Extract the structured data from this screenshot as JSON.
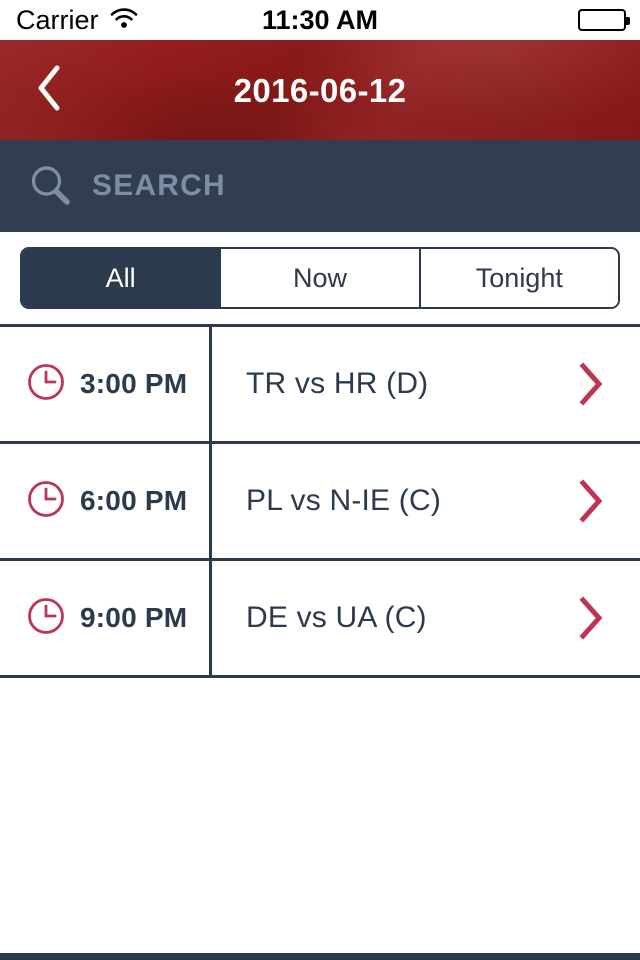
{
  "status_bar": {
    "carrier": "Carrier",
    "wifi_icon": "wifi-icon",
    "time": "11:30 AM",
    "battery_icon": "battery-full-icon"
  },
  "header": {
    "back_icon": "chevron-left-icon",
    "title": "2016-06-12",
    "background_color": "#8f1b1b"
  },
  "search": {
    "icon": "search-icon",
    "placeholder": "SEARCH",
    "value": "",
    "background_color": "#313e51",
    "placeholder_color": "#7e8da3"
  },
  "filters": {
    "selected": "All",
    "options": [
      {
        "label": "All",
        "active": true
      },
      {
        "label": "Now",
        "active": false
      },
      {
        "label": "Tonight",
        "active": false
      }
    ]
  },
  "colors": {
    "navy": "#2c3a4d",
    "crimson": "#be3455",
    "header_red": "#8f1b1b"
  },
  "matches": {
    "time_icon": "clock-icon",
    "disclosure_icon": "chevron-right-icon",
    "rows": [
      {
        "time": "3:00 PM",
        "match": "TR vs HR (D)"
      },
      {
        "time": "6:00 PM",
        "match": "PL vs N-IE (C)"
      },
      {
        "time": "9:00 PM",
        "match": "DE vs UA (C)"
      }
    ]
  }
}
